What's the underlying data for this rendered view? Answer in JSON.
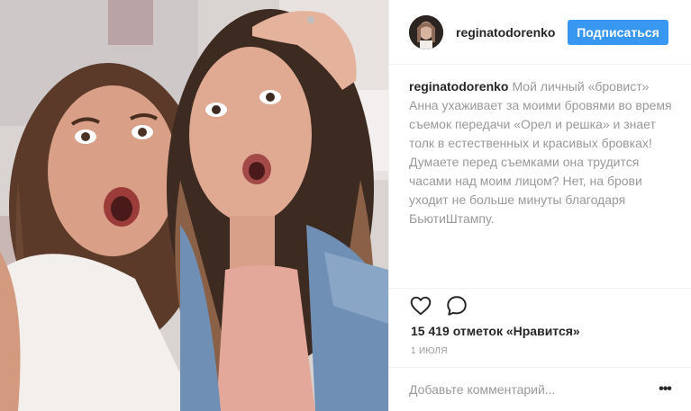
{
  "post": {
    "photo_alt": "photo",
    "username": "reginatodorenko",
    "follow_label": "Подписаться",
    "caption": {
      "username": "reginatodorenko",
      "text": "Мой личный «бровист» Анна ухаживает за моими бровями во время съемок передачи «Орел и решка» и знает толк в естественных и красивых бровках! Думаете перед съемками она трудится часами над моим лицом? Нет, на брови уходит не больше минуты благодаря БьютиШтампу."
    },
    "likes_text": "15 419 отметок «Нравится»",
    "date": "1 ИЮЛЯ",
    "comment_placeholder": "Добавьте комментарий...",
    "more_label": "•••"
  },
  "icons": {
    "like": "heart-outline-icon",
    "comment": "speech-bubble-icon",
    "more": "ellipsis-icon"
  },
  "colors": {
    "follow_button": "#3897f0",
    "muted_text": "#999999",
    "text": "#262626",
    "divider": "#efefef"
  }
}
